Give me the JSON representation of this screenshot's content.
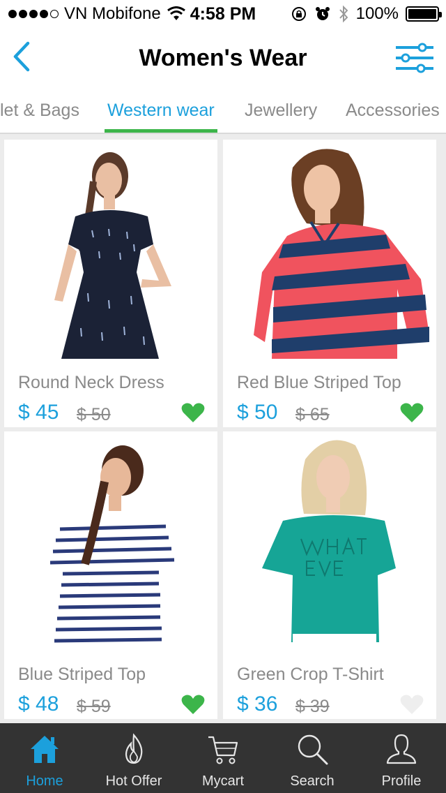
{
  "status_bar": {
    "carrier": "VN Mobifone",
    "time": "4:58 PM",
    "battery": "100%"
  },
  "header": {
    "title": "Women's Wear",
    "back_icon": "chevron-left-icon",
    "filter_icon": "sliders-icon"
  },
  "tabs": [
    {
      "label": "let & Bags",
      "active": false
    },
    {
      "label": "Western wear",
      "active": true
    },
    {
      "label": "Jewellery",
      "active": false
    },
    {
      "label": "Accessories",
      "active": false
    }
  ],
  "products": [
    {
      "name": "Round Neck Dress",
      "price": "$ 45",
      "old_price": "$ 50",
      "favorite": true
    },
    {
      "name": "Red Blue Striped Top",
      "price": "$ 50",
      "old_price": "$ 65",
      "favorite": true
    },
    {
      "name": "Blue Striped Top",
      "price": "$ 48",
      "old_price": "$ 59",
      "favorite": true
    },
    {
      "name": "Green Crop T-Shirt",
      "price": "$ 36",
      "old_price": "$ 39",
      "favorite": false
    }
  ],
  "tab_bar": [
    {
      "label": "Home",
      "icon": "home-icon",
      "active": true
    },
    {
      "label": "Hot Offer",
      "icon": "flame-icon",
      "active": false
    },
    {
      "label": "Mycart",
      "icon": "cart-icon",
      "active": false
    },
    {
      "label": "Search",
      "icon": "search-icon",
      "active": false
    },
    {
      "label": "Profile",
      "icon": "profile-icon",
      "active": false
    }
  ],
  "colors": {
    "accent": "#1ca0dc",
    "tab_indicator": "#3cb54a",
    "favorite": "#3cb54a",
    "tab_bar_bg": "#333333"
  }
}
